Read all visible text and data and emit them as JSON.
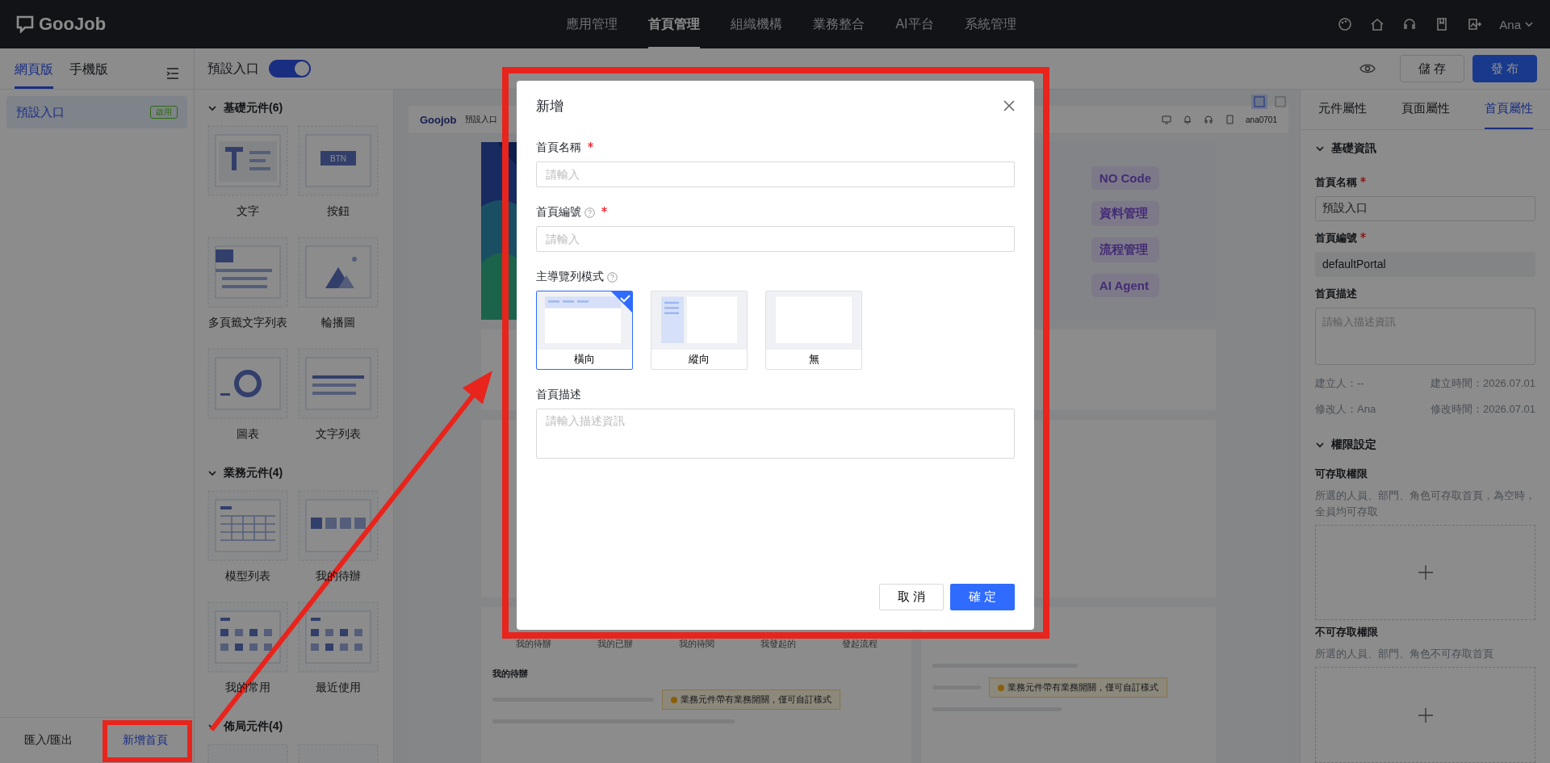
{
  "top_nav": {
    "logo": "GooJob",
    "items": [
      {
        "label": "應用管理",
        "selected": false
      },
      {
        "label": "首頁管理",
        "selected": true
      },
      {
        "label": "組織機構",
        "selected": false
      },
      {
        "label": "業務整合",
        "selected": false
      },
      {
        "label": "AI平台",
        "selected": false
      },
      {
        "label": "系統管理",
        "selected": false
      }
    ],
    "user": "Ana"
  },
  "left_panel": {
    "tabs": [
      {
        "label": "網頁版",
        "selected": true
      },
      {
        "label": "手機版",
        "selected": false
      }
    ],
    "pages": [
      {
        "name": "預設入口",
        "badge": "啟用",
        "selected": true
      }
    ],
    "footer": [
      {
        "label": "匯入/匯出",
        "kind": "plain"
      },
      {
        "label": "新增首頁",
        "kind": "link"
      }
    ]
  },
  "toolbar": {
    "page_name": "預設入口",
    "enabled": true,
    "save": "儲 存",
    "publish": "發 布"
  },
  "components": [
    {
      "title": "基礎元件(6)",
      "expanded": true,
      "button_thumb_text": "BTN",
      "items": [
        {
          "label": "文字",
          "kind": "text"
        },
        {
          "label": "按鈕",
          "kind": "button"
        },
        {
          "label": "多頁籤文字列表",
          "kind": "tabs"
        },
        {
          "label": "輪播圖",
          "kind": "carousel"
        },
        {
          "label": "圖表",
          "kind": "chart"
        },
        {
          "label": "文字列表",
          "kind": "list"
        }
      ]
    },
    {
      "title": "業務元件(4)",
      "expanded": true,
      "items": [
        {
          "label": "模型列表",
          "kind": "table"
        },
        {
          "label": "我的待辦",
          "kind": "todo"
        },
        {
          "label": "我的常用",
          "kind": "grid"
        },
        {
          "label": "最近使用",
          "kind": "grid"
        }
      ]
    },
    {
      "title": "佈局元件(4)",
      "expanded": true,
      "items": [
        {
          "kind": "blank"
        },
        {
          "kind": "blank"
        }
      ]
    }
  ],
  "preview": {
    "logo": "Goojob",
    "page_name": "預設入口",
    "user": "ana0701",
    "tags": [
      "NO Code",
      "資料管理",
      "流程管理",
      "AI Agent"
    ],
    "stats": [
      "我的待辦",
      "我的已辦",
      "我的待閱",
      "我發起的",
      "發起流程"
    ],
    "todo_title": "我的待辦",
    "notices": [
      "業務元件帶有業務開關，僅可自訂樣式",
      "業務元件帶有業務開關，僅可自訂樣式"
    ]
  },
  "right_panel": {
    "tabs": [
      {
        "label": "元件屬性",
        "selected": false
      },
      {
        "label": "頁面屬性",
        "selected": false
      },
      {
        "label": "首頁屬性",
        "selected": true
      }
    ],
    "basic": {
      "title": "基礎資訊",
      "expanded": true,
      "fields": [
        {
          "label": "首頁名稱",
          "required": true,
          "value": "預設入口",
          "disabled": false
        },
        {
          "label": "首頁編號",
          "required": true,
          "value": "defaultPortal",
          "disabled": true
        }
      ],
      "desc_label": "首頁描述",
      "desc_placeholder": "請輸入描述資訊",
      "meta": [
        [
          "建立人：--",
          "建立時間：2026.07.01"
        ],
        [
          "修改人：Ana",
          "修改時間：2026.07.01"
        ]
      ]
    },
    "permissions": {
      "title": "權限設定",
      "expanded": true,
      "groups": [
        {
          "title": "可存取權限",
          "desc": "所選的人員、部門、角色可存取首頁，為空時，全員均可存取"
        },
        {
          "title": "不可存取權限",
          "desc": "所選的人員、部門、角色不可存取首頁"
        }
      ]
    }
  },
  "modal": {
    "title": "新增",
    "fields": [
      {
        "label": "首頁名稱",
        "kind": "input",
        "required": true,
        "help": false,
        "placeholder": "請輸入"
      },
      {
        "label": "首頁編號",
        "kind": "input",
        "required": true,
        "help": true,
        "placeholder": "請輸入"
      },
      {
        "label": "主導覽列模式",
        "kind": "layout",
        "required": false,
        "help": true,
        "options": [
          {
            "label": "橫向",
            "kind": "horizontal",
            "selected": true
          },
          {
            "label": "縱向",
            "kind": "vertical",
            "selected": false
          },
          {
            "label": "無",
            "kind": "none",
            "selected": false
          }
        ]
      },
      {
        "label": "首頁描述",
        "kind": "textarea",
        "required": false,
        "help": false,
        "placeholder": "請輸入描述資訊"
      }
    ],
    "buttons": [
      {
        "label": "取 消",
        "kind": "secondary"
      },
      {
        "label": "確 定",
        "kind": "primary"
      }
    ]
  }
}
